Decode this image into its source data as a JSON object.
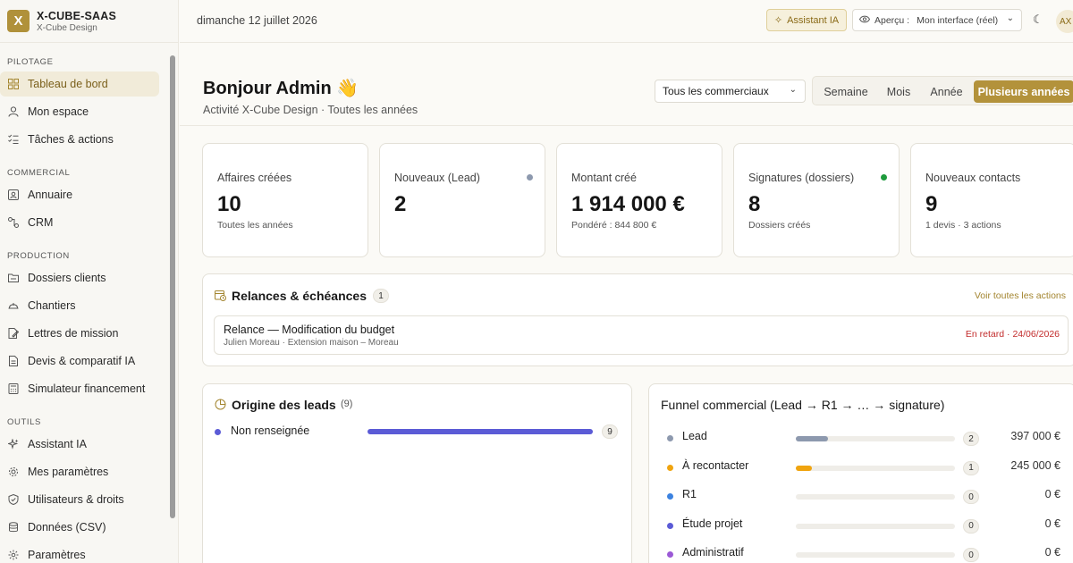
{
  "brand": {
    "logo_letter": "X",
    "name": "X-CUBE-SAAS",
    "subtitle": "X-Cube Design"
  },
  "sidebar": {
    "sections": [
      {
        "title": "PILOTAGE",
        "items": [
          {
            "label": "Tableau de bord",
            "icon": "dashboard-icon",
            "active": true
          },
          {
            "label": "Mon espace",
            "icon": "user-icon"
          },
          {
            "label": "Tâches & actions",
            "icon": "checklist-icon"
          }
        ]
      },
      {
        "title": "COMMERCIAL",
        "items": [
          {
            "label": "Annuaire",
            "icon": "contact-card-icon"
          },
          {
            "label": "CRM",
            "icon": "workflow-icon"
          }
        ]
      },
      {
        "title": "PRODUCTION",
        "items": [
          {
            "label": "Dossiers clients",
            "icon": "folder-icon"
          },
          {
            "label": "Chantiers",
            "icon": "helmet-icon"
          },
          {
            "label": "Lettres de mission",
            "icon": "document-edit-icon"
          },
          {
            "label": "Devis & comparatif IA",
            "icon": "document-icon"
          },
          {
            "label": "Simulateur financement",
            "icon": "calculator-icon"
          }
        ]
      },
      {
        "title": "OUTILS",
        "items": [
          {
            "label": "Assistant IA",
            "icon": "sparkles-icon"
          },
          {
            "label": "Mes paramètres",
            "icon": "gear-icon"
          },
          {
            "label": "Utilisateurs & droits",
            "icon": "shield-icon"
          },
          {
            "label": "Données (CSV)",
            "icon": "database-icon"
          },
          {
            "label": "Paramètres",
            "icon": "settings-icon"
          }
        ]
      }
    ]
  },
  "topbar": {
    "date": "dimanche 12 juillet 2026",
    "assistant_label": "Assistant IA",
    "preview_label": "Aperçu :",
    "preview_value": "Mon interface (réel)",
    "avatar_initials": "AX"
  },
  "header": {
    "greeting": "Bonjour Admin 👋",
    "subtitle": "Activité X-Cube Design · Toutes les années",
    "filter_value": "Tous les commerciaux",
    "periods": [
      "Semaine",
      "Mois",
      "Année",
      "Plusieurs années"
    ],
    "active_period": "Plusieurs années"
  },
  "kpis": [
    {
      "label": "Affaires créées",
      "value": "10",
      "note": "Toutes les années",
      "dot": ""
    },
    {
      "label": "Nouveaux (Lead)",
      "value": "2",
      "note": "",
      "dot": "#8d99ae"
    },
    {
      "label": "Montant créé",
      "value": "1 914 000 €",
      "note": "Pondéré : 844 800 €",
      "dot": ""
    },
    {
      "label": "Signatures (dossiers)",
      "value": "8",
      "note": "Dossiers créés",
      "dot": "#1e9b3d"
    },
    {
      "label": "Nouveaux contacts",
      "value": "9",
      "note": "1 devis · 3 actions",
      "dot": ""
    }
  ],
  "relances": {
    "title": "Relances & échéances",
    "count": "1",
    "link": "Voir toutes les actions",
    "item": {
      "title": "Relance — Modification du budget",
      "subtitle": "Julien Moreau · Extension maison – Moreau",
      "status": "En retard · 24/06/2026"
    }
  },
  "leads": {
    "title": "Origine des leads",
    "count": "(9)",
    "rows": [
      {
        "label": "Non renseignée",
        "value": 9,
        "share": 1.0,
        "color": "#5b5bd6"
      }
    ]
  },
  "funnel": {
    "title": "Funnel commercial (Lead → R1 → … → signature)",
    "rows": [
      {
        "label": "Lead",
        "count": 2,
        "share": 0.2,
        "amount": "397 000 €",
        "color": "#8d99ae"
      },
      {
        "label": "À recontacter",
        "count": 1,
        "share": 0.1,
        "amount": "245 000 €",
        "color": "#f0a40f"
      },
      {
        "label": "R1",
        "count": 0,
        "share": 0,
        "amount": "0 €",
        "color": "#3c82e0"
      },
      {
        "label": "Étude projet",
        "count": 0,
        "share": 0,
        "amount": "0 €",
        "color": "#5b5bd6"
      },
      {
        "label": "Administratif",
        "count": 0,
        "share": 0,
        "amount": "0 €",
        "color": "#9b59d6"
      }
    ]
  },
  "colors": {
    "accent": "#b3923b",
    "overdue": "#c22b2b"
  }
}
